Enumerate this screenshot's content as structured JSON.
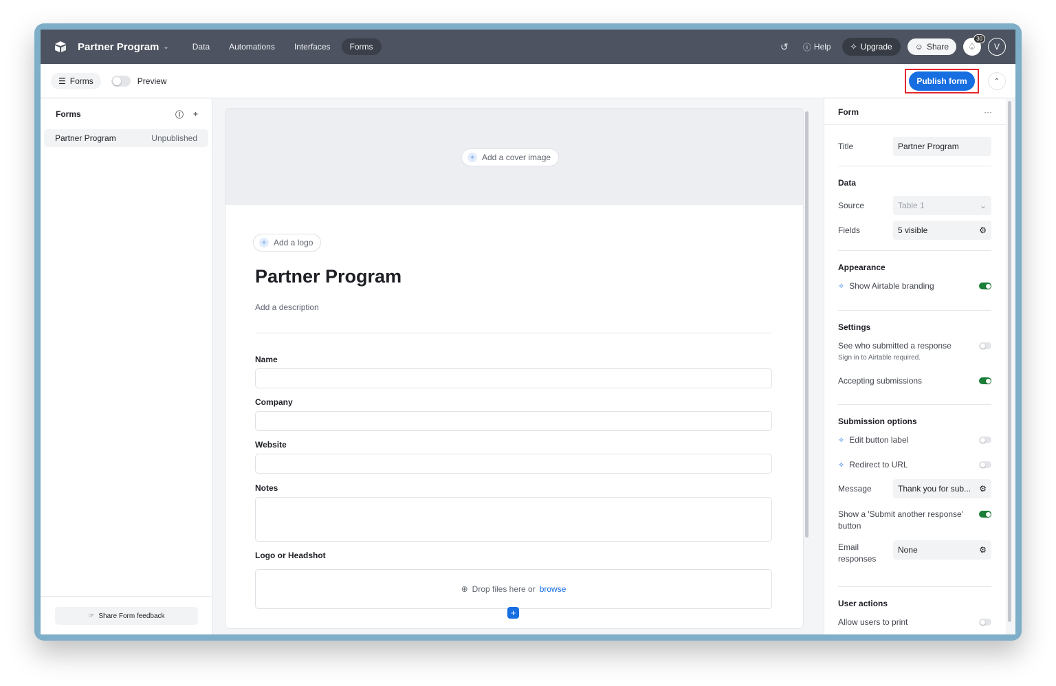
{
  "topbar": {
    "base_name": "Partner Program",
    "nav": [
      "Data",
      "Automations",
      "Interfaces",
      "Forms"
    ],
    "active_nav": "Forms",
    "help_label": "Help",
    "upgrade_label": "Upgrade",
    "share_label": "Share",
    "notification_count": "30",
    "avatar_initial": "V"
  },
  "toolbar": {
    "forms_label": "Forms",
    "preview_label": "Preview",
    "publish_label": "Publish form"
  },
  "sidebar": {
    "title": "Forms",
    "items": [
      {
        "name": "Partner Program",
        "status": "Unpublished"
      }
    ],
    "feedback_label": "Share Form feedback"
  },
  "form": {
    "cover_label": "Add a cover image",
    "logo_label": "Add a logo",
    "title": "Partner Program",
    "description_placeholder": "Add a description",
    "fields": [
      {
        "label": "Name"
      },
      {
        "label": "Company"
      },
      {
        "label": "Website"
      },
      {
        "label": "Notes"
      },
      {
        "label": "Logo or Headshot"
      }
    ],
    "drop_text": "Drop files here or",
    "browse_label": "browse"
  },
  "panel": {
    "header": "Form",
    "title_label": "Title",
    "title_value": "Partner Program",
    "data_section": "Data",
    "source_label": "Source",
    "source_value": "Table 1",
    "fields_label": "Fields",
    "fields_value": "5 visible",
    "appearance_section": "Appearance",
    "branding_label": "Show Airtable branding",
    "branding_on": true,
    "settings_section": "Settings",
    "see_who_label": "See who submitted a response",
    "see_who_note": "Sign in to Airtable required.",
    "see_who_on": false,
    "accepting_label": "Accepting submissions",
    "accepting_on": true,
    "submission_section": "Submission options",
    "edit_button_label": "Edit button label",
    "redirect_label": "Redirect to URL",
    "message_label": "Message",
    "message_value": "Thank you for sub...",
    "submit_another_label": "Show a 'Submit another response' button",
    "submit_another_on": true,
    "email_label": "Email responses",
    "email_value": "None",
    "user_actions_section": "User actions",
    "allow_print_label": "Allow users to print"
  },
  "colors": {
    "topbar": "#4d5360",
    "accent": "#166ee1",
    "toggle_on": "#1a7f37",
    "highlight": "#e5262d"
  }
}
